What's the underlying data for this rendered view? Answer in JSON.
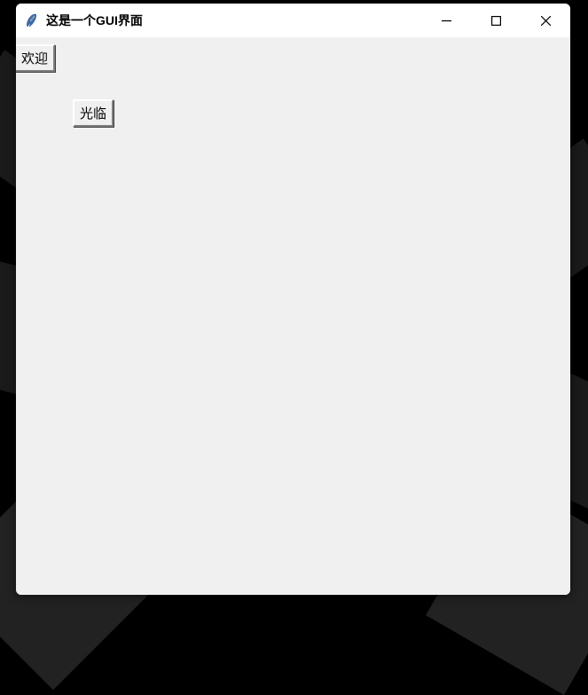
{
  "window": {
    "title": "这是一个GUI界面"
  },
  "buttons": {
    "welcome": "欢迎",
    "visit": "光临"
  }
}
